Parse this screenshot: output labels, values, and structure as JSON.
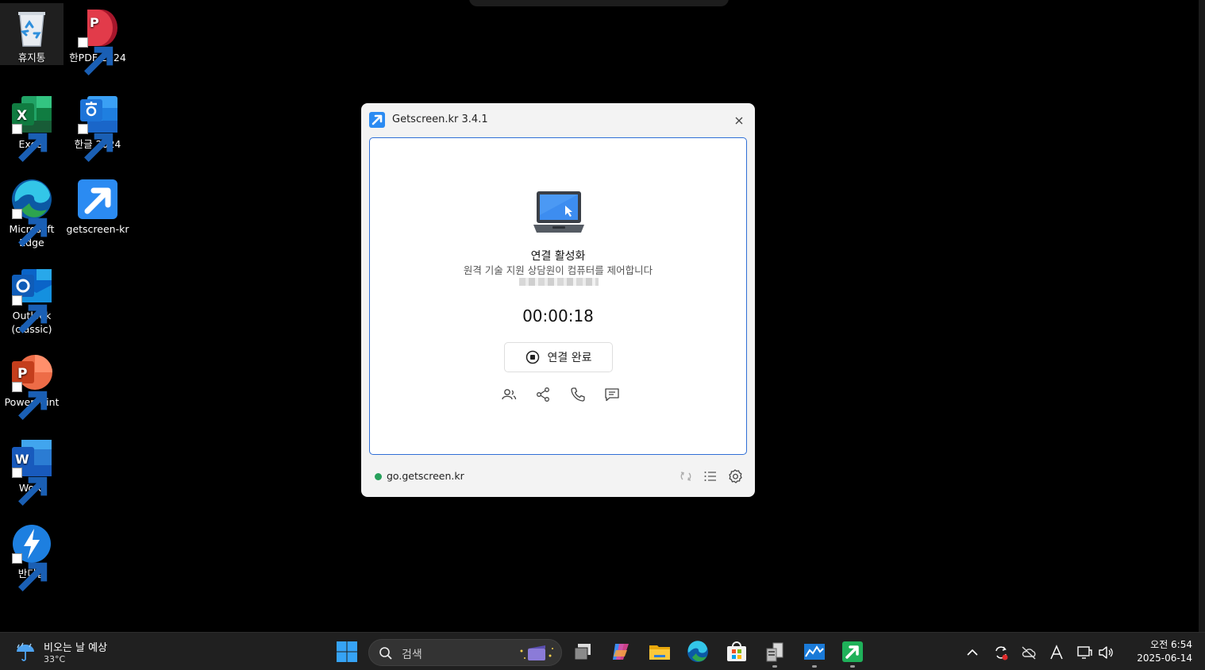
{
  "desktop": {
    "icons": [
      {
        "label": "휴지통"
      },
      {
        "label": "한PDF 2024"
      },
      {
        "label": "Excel"
      },
      {
        "label": "한글 2024"
      },
      {
        "label": "Microsoft Edge"
      },
      {
        "label": "getscreen-kr"
      },
      {
        "label": "Outlook (classic)"
      },
      {
        "label": "PowerPoint"
      },
      {
        "label": "Word"
      },
      {
        "label": "반디집"
      }
    ]
  },
  "dialog": {
    "title": "Getscreen.kr 3.4.1",
    "status_title": "연결 활성화",
    "status_subtitle": "원격 기술 지원 상담원이 컴퓨터를 제어합니다",
    "timer": "00:00:18",
    "disconnect_label": "연결 완료",
    "footer_url": "go.getscreen.kr",
    "accent_color": "#2f6fd6",
    "online_color": "#27a05b"
  },
  "taskbar": {
    "weather_title": "비오는 날 예상",
    "weather_temp": "33°C",
    "search_placeholder": "검색",
    "clock_time": "오전 6:54",
    "clock_date": "2025-06-14"
  }
}
